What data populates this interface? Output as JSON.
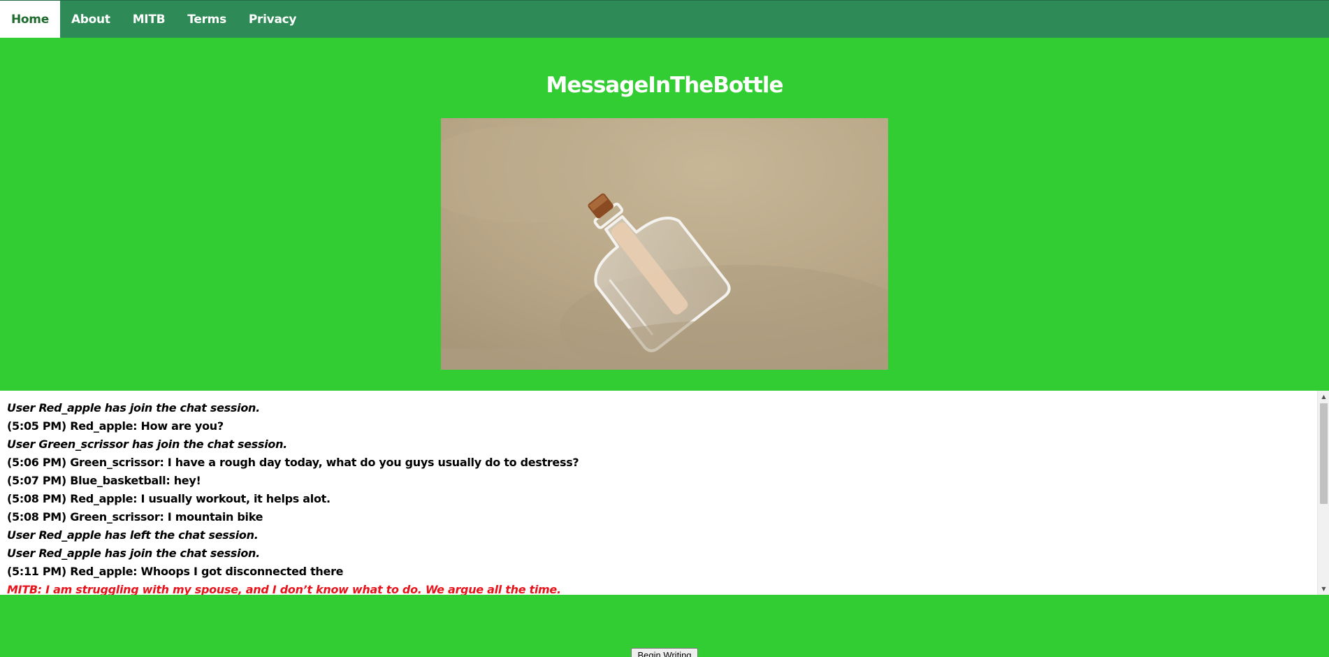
{
  "nav": {
    "items": [
      {
        "label": "Home",
        "active": true
      },
      {
        "label": "About",
        "active": false
      },
      {
        "label": "MITB",
        "active": false
      },
      {
        "label": "Terms",
        "active": false
      },
      {
        "label": "Privacy",
        "active": false
      }
    ]
  },
  "site_title": "MessageInTheBottle",
  "hero_image": {
    "subject": "bottle-with-message-in-sand"
  },
  "chat": {
    "lines": [
      {
        "text": "User Red_apple has join the chat session.",
        "kind": "system"
      },
      {
        "text": "(5:05 PM) Red_apple: How are you?",
        "kind": "message"
      },
      {
        "text": "User Green_scrissor has join the chat session.",
        "kind": "system"
      },
      {
        "text": "(5:06 PM) Green_scrissor: I have a rough day today, what do you guys usually do to destress?",
        "kind": "message"
      },
      {
        "text": "(5:07 PM) Blue_basketball: hey!",
        "kind": "message"
      },
      {
        "text": "(5:08 PM) Red_apple: I usually workout, it helps alot.",
        "kind": "message"
      },
      {
        "text": "(5:08 PM) Green_scrissor: I mountain bike",
        "kind": "message"
      },
      {
        "text": "User Red_apple has left the chat session.",
        "kind": "system"
      },
      {
        "text": "User Red_apple has join the chat session.",
        "kind": "system"
      },
      {
        "text": "(5:11 PM) Red_apple: Whoops I got disconnected there",
        "kind": "message"
      },
      {
        "text": "MITB: I am struggling with my spouse, and I don’t know what to do. We argue all the time.",
        "kind": "mitb"
      }
    ]
  },
  "begin_button": {
    "label": "Begin Writing"
  },
  "colors": {
    "page_bg": "#32cd32",
    "navbar_bg": "#2e8b57",
    "active_nav_text": "#1e6b2e",
    "mitb_text": "#e8141c"
  }
}
